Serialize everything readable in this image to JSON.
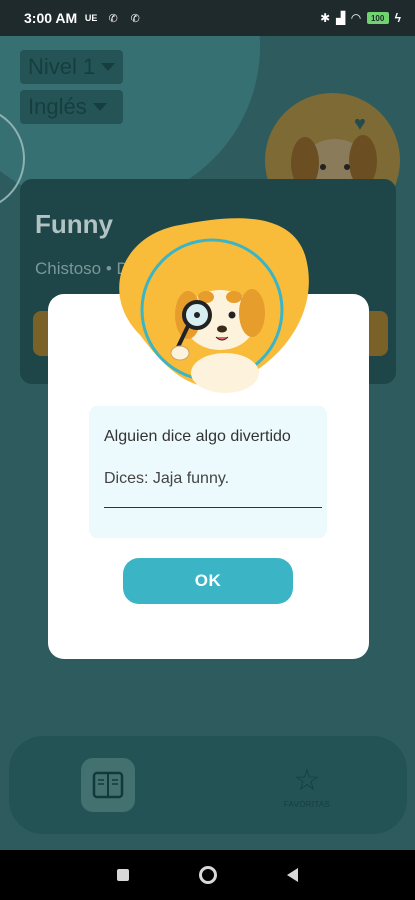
{
  "status_bar": {
    "time": "3:00 AM",
    "badges": [
      "UE",
      "phone-icon",
      "phone-icon"
    ],
    "battery": "100"
  },
  "filters": {
    "level": "Nivel 1",
    "language": "Inglés"
  },
  "card": {
    "word": "Funny",
    "translation": "Chistoso • Di"
  },
  "dialog": {
    "scenario": "Alguien dice algo divertido",
    "answer": "Dices: Jaja funny.",
    "ok_label": "OK"
  },
  "bottom_nav": {
    "favorites_label": "FAVORITAS"
  },
  "colors": {
    "accent": "#3bb5c6",
    "yellow": "#f9bb3a",
    "teal_bg": "#2e5c5e"
  }
}
